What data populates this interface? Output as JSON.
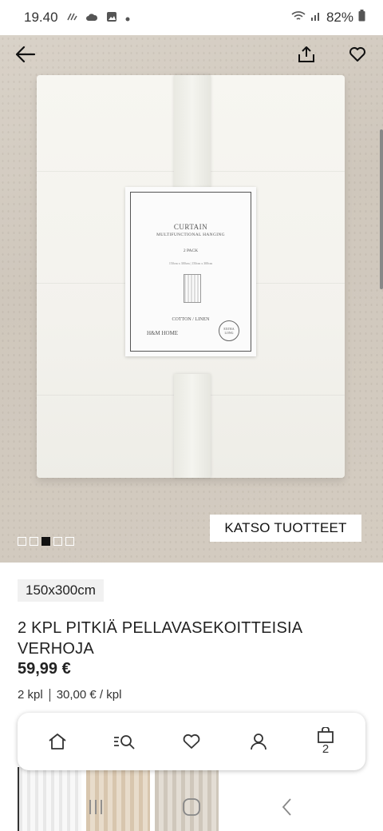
{
  "status_bar": {
    "time": "19.40",
    "battery": "82%",
    "icons": [
      "signal-dots-icon",
      "cloud-icon",
      "gallery-icon",
      "notification-dot-icon",
      "wifi-icon",
      "cell-signal-icon",
      "battery-icon"
    ]
  },
  "hero": {
    "tag": {
      "title": "CURTAIN",
      "subtitle": "MULTIFUNCTIONAL HANGING",
      "pack": "2 PACK",
      "sizes": "150cm x 300cm  |  150cm x 300cm",
      "material": "COTTON / LINEN",
      "brand": "H&M HOME",
      "badge_line1": "EXTRA",
      "badge_line2": "LONG"
    },
    "see_products_label": "KATSO TUOTTEET",
    "carousel": {
      "count": 5,
      "active_index": 2
    }
  },
  "product": {
    "size": "150x300cm",
    "title": "2 KPL PITKIÄ PELLAVASEKOITTEISIA VERHOJA",
    "price": "59,99 €",
    "quantity": "2 kpl",
    "unit_price": "30,00 € / kpl"
  },
  "bottom_nav": {
    "items": [
      "home-icon",
      "search-icon",
      "heart-icon",
      "user-icon",
      "bag-icon"
    ],
    "bag_count": "2"
  },
  "system_nav": [
    "recents-icon",
    "home-circle-icon",
    "back-chevron-icon"
  ],
  "colors": {
    "accent": "#111111",
    "chip_bg": "#f1f1f1",
    "hero_bg": "#d4ccc1"
  }
}
